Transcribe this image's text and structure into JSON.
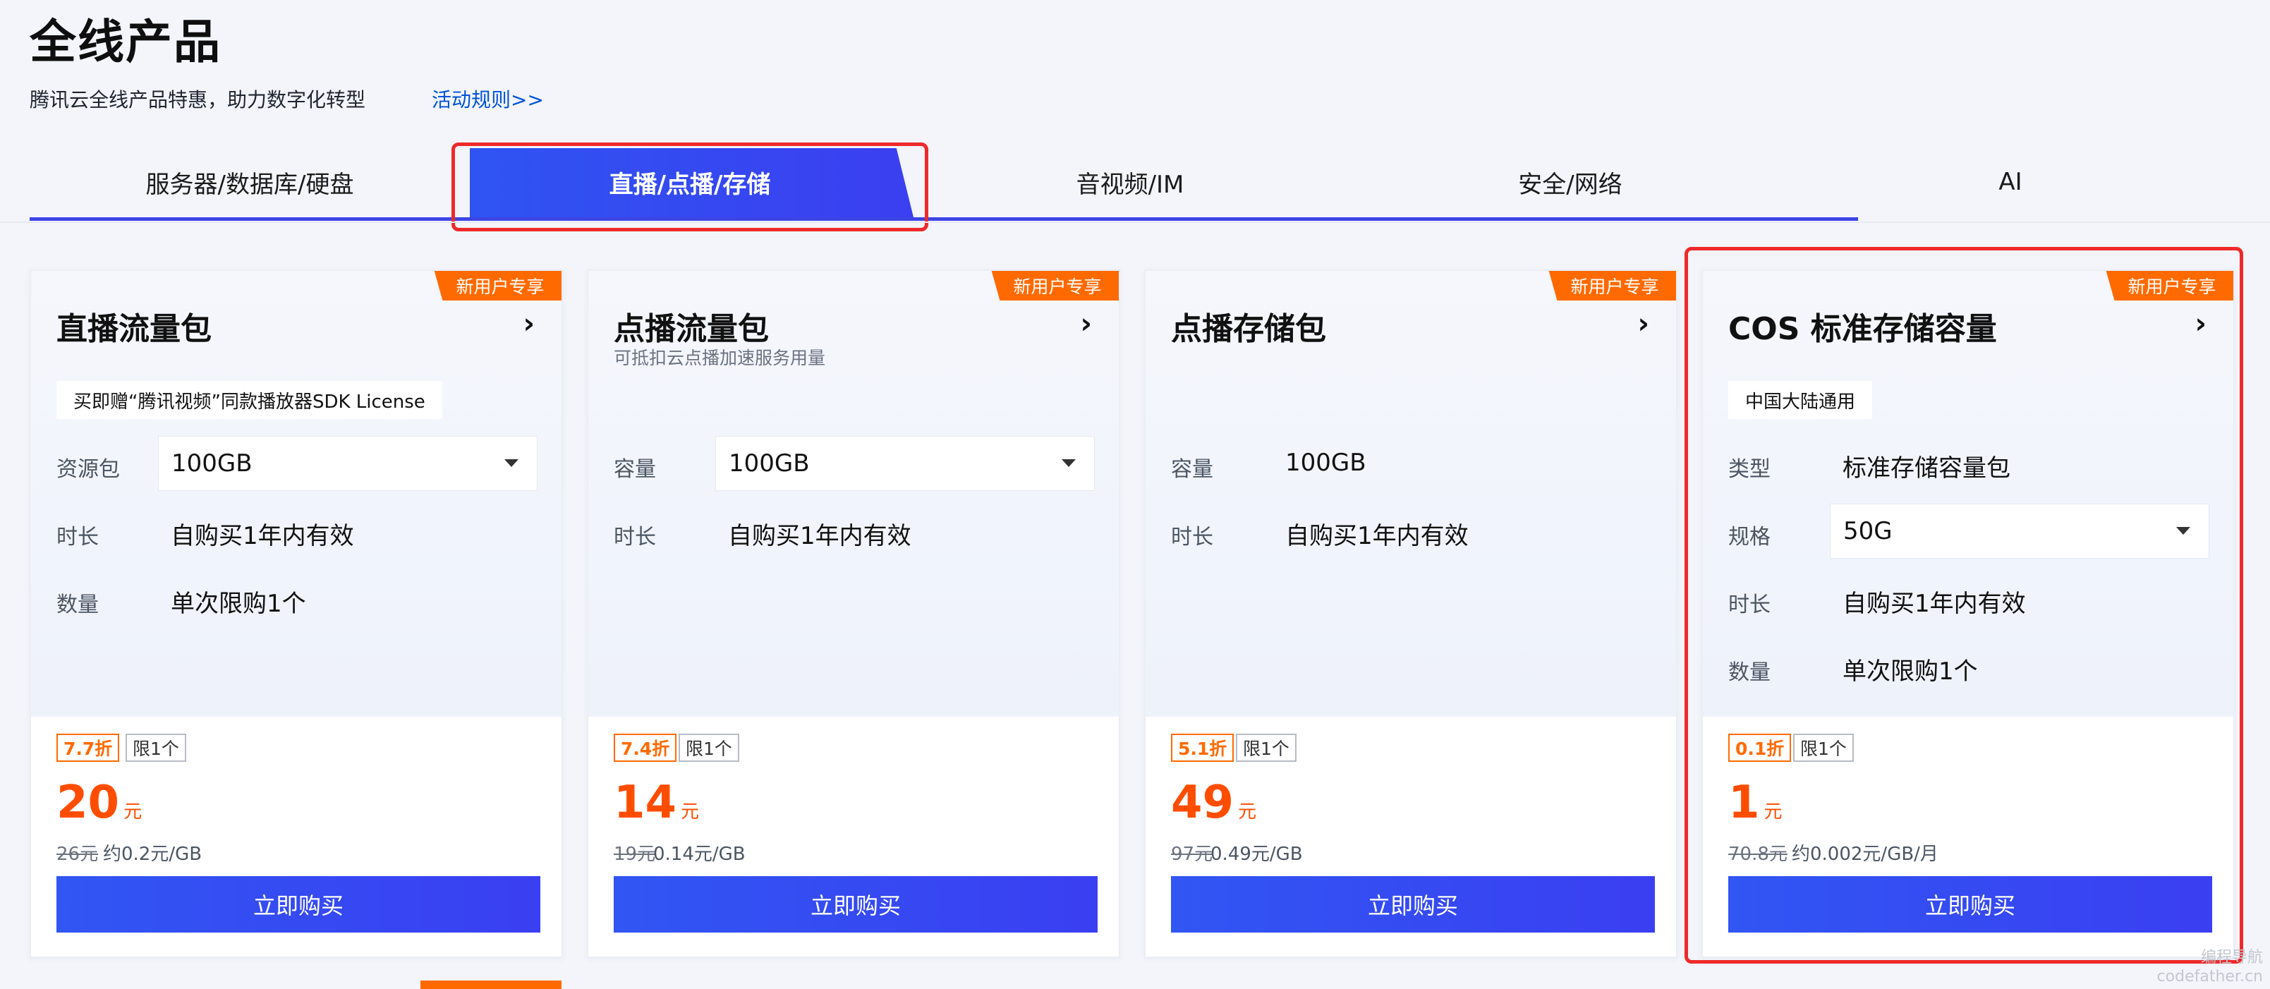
{
  "header": {
    "title": "全线产品",
    "subtitle": "腾讯云全线产品特惠，助力数字化转型",
    "rules_link": "活动规则>>"
  },
  "tabs": [
    {
      "label": "服务器/数据库/硬盘",
      "active": false
    },
    {
      "label": "直播/点播/存储",
      "active": true
    },
    {
      "label": "音视频/IM",
      "active": false
    },
    {
      "label": "安全/网络",
      "active": false
    },
    {
      "label": "AI",
      "active": false
    }
  ],
  "colors": {
    "accent": "#3a3ff0",
    "discount": "#ff6a00",
    "price": "#ff4d00",
    "highlight": "#ee2a2a"
  },
  "cards": [
    {
      "badge": "新用户专享",
      "title": "直播流量包",
      "tag": "买即赠“腾讯视频”同款播放器SDK License",
      "rows": [
        {
          "label": "资源包",
          "value": "100GB"
        },
        {
          "label": "时长",
          "value": "自购买1年内有效"
        },
        {
          "label": "数量",
          "value": "单次限购1个"
        }
      ],
      "discount": "7.7折",
      "limit": "限1个",
      "price": "20",
      "price_unit": "元",
      "original_price": "26元",
      "unit_price": "约0.2元/GB",
      "buy_label": "立即购买"
    },
    {
      "badge": "新用户专享",
      "title": "点播流量包",
      "subtitle": "可抵扣云点播加速服务用量",
      "rows": [
        {
          "label": "容量",
          "value": "100GB"
        },
        {
          "label": "时长",
          "value": "自购买1年内有效"
        }
      ],
      "discount": "7.4折",
      "limit": "限1个",
      "price": "14",
      "price_unit": "元",
      "original_price": "19元",
      "unit_price": "0.14元/GB",
      "buy_label": "立即购买"
    },
    {
      "badge": "新用户专享",
      "title": "点播存储包",
      "rows": [
        {
          "label": "容量",
          "value": "100GB"
        },
        {
          "label": "时长",
          "value": "自购买1年内有效"
        }
      ],
      "discount": "5.1折",
      "limit": "限1个",
      "price": "49",
      "price_unit": "元",
      "original_price": "97元",
      "unit_price": "0.49元/GB",
      "buy_label": "立即购买"
    },
    {
      "badge": "新用户专享",
      "title": "COS 标准存储容量",
      "tag": "中国大陆通用",
      "rows": [
        {
          "label": "类型",
          "value": "标准存储容量包"
        },
        {
          "label": "规格",
          "value": "50G"
        },
        {
          "label": "时长",
          "value": "自购买1年内有效"
        },
        {
          "label": "数量",
          "value": "单次限购1个"
        }
      ],
      "discount": "0.1折",
      "limit": "限1个",
      "price": "1",
      "price_unit": "元",
      "original_price": "70.8元",
      "unit_price": "约0.002元/GB/月",
      "buy_label": "立即购买"
    }
  ],
  "watermark": [
    "编程导航",
    "codefather.cn"
  ]
}
